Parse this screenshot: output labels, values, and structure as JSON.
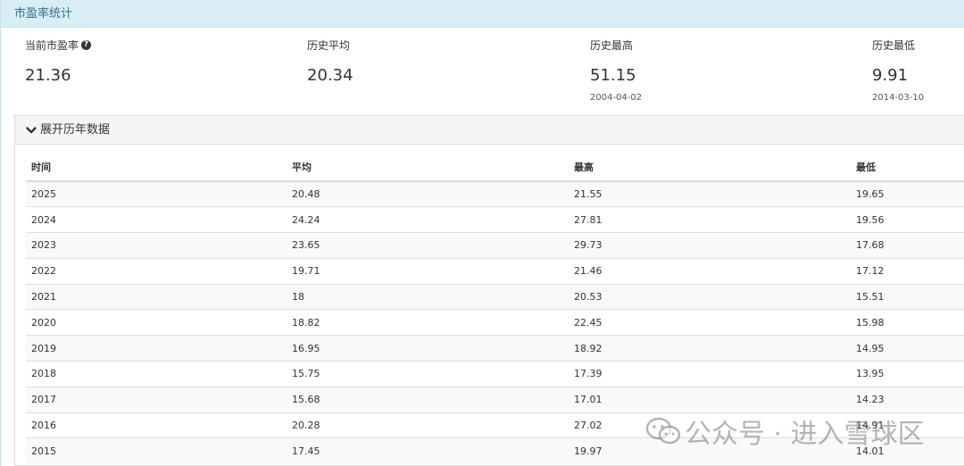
{
  "panel": {
    "title": "市盈率统计"
  },
  "stats": [
    {
      "label": "当前市盈率",
      "value": "21.36",
      "date": ""
    },
    {
      "label": "历史平均",
      "value": "20.34",
      "date": ""
    },
    {
      "label": "历史最高",
      "value": "51.15",
      "date": "2004-04-02"
    },
    {
      "label": "历史最低",
      "value": "9.91",
      "date": "2014-03-10"
    }
  ],
  "expand": {
    "label": "展开历年数据"
  },
  "table": {
    "headers": [
      "时间",
      "平均",
      "最高",
      "最低"
    ],
    "rows": [
      [
        "2025",
        "20.48",
        "21.55",
        "19.65"
      ],
      [
        "2024",
        "24.24",
        "27.81",
        "19.56"
      ],
      [
        "2023",
        "23.65",
        "29.73",
        "17.68"
      ],
      [
        "2022",
        "19.71",
        "21.46",
        "17.12"
      ],
      [
        "2021",
        "18",
        "20.53",
        "15.51"
      ],
      [
        "2020",
        "18.82",
        "22.45",
        "15.98"
      ],
      [
        "2019",
        "16.95",
        "18.92",
        "14.95"
      ],
      [
        "2018",
        "15.75",
        "17.39",
        "13.95"
      ],
      [
        "2017",
        "15.68",
        "17.01",
        "14.23"
      ],
      [
        "2016",
        "20.28",
        "27.02",
        "14.91"
      ],
      [
        "2015",
        "17.45",
        "19.97",
        "14.01"
      ]
    ]
  },
  "watermark": {
    "text": "公众号 · 进入雪球区"
  },
  "colors": {
    "heading_bg": "#d9edf7",
    "heading_text": "#31708f",
    "border": "#dddddd"
  }
}
